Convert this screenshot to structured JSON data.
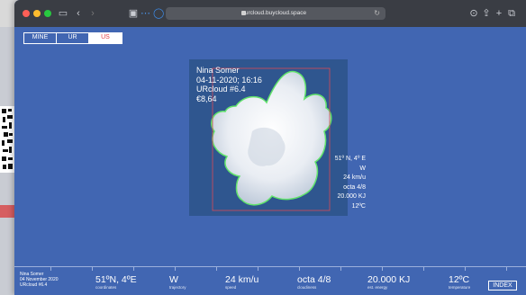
{
  "browser": {
    "url": "urcloud.buycloud.space"
  },
  "lang": {
    "items": [
      "MINE",
      "UR",
      "US"
    ],
    "active": "US"
  },
  "info": {
    "name": "Nina Somer",
    "datetime": "04-11-2020; 16:16",
    "id": "URcloud #6.4",
    "price": "€8,64"
  },
  "stats": {
    "coords": "51º N, 4º E",
    "trajectory": "W",
    "speed": "24 km/u",
    "cloudiness": "octa 4/8",
    "energy": "20.000 KJ",
    "temperature": "12ºC"
  },
  "footer": {
    "name": "Nina Somer",
    "date": "04 November 2020",
    "id": "URcloud #6.4",
    "coordinates": {
      "value": "51ºN, 4ºE",
      "label": "coordinates"
    },
    "trajectory": {
      "value": "W",
      "label": "trajectory"
    },
    "speed": {
      "value": "24 km/u",
      "label": "speed"
    },
    "cloudiness": {
      "value": "octa 4/8",
      "label": "cloudiness"
    },
    "energy": {
      "value": "20.000 KJ",
      "label": "est. energy"
    },
    "temperature": {
      "value": "12ºC",
      "label": "temperature"
    },
    "index_label": "INDEX"
  },
  "colors": {
    "page_blue": "#4166b2",
    "active_lang_text": "#e23b43",
    "cloud_outline": "#61e36b",
    "bounding_box": "#d84a57"
  }
}
